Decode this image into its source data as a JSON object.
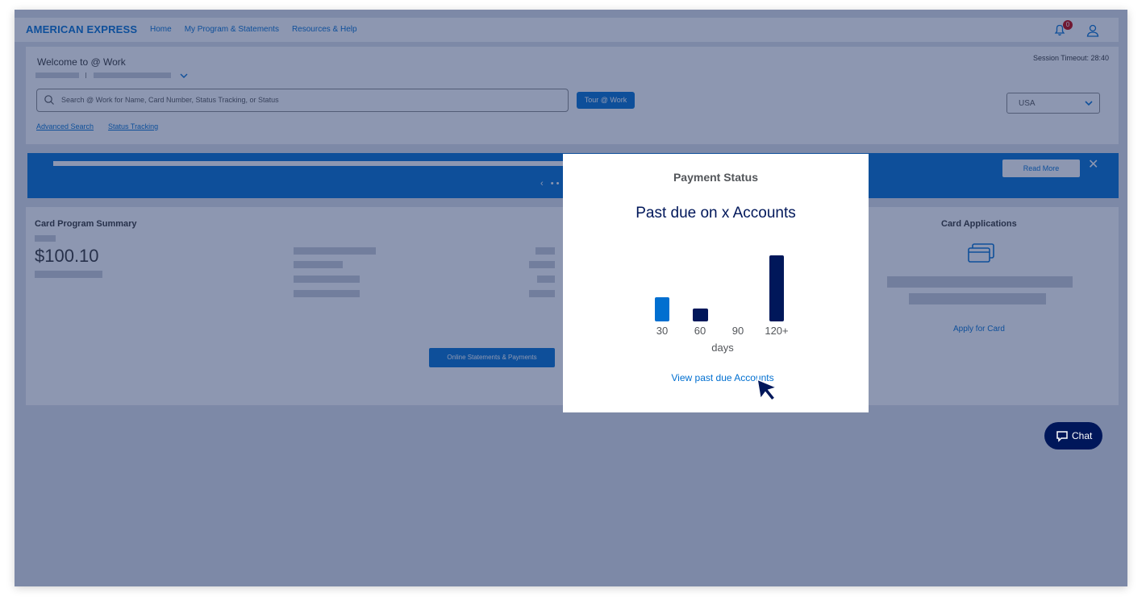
{
  "brand": {
    "logo": "AMERICAN EXPRESS",
    "accent": "#016fd0",
    "navy": "#00175a"
  },
  "nav": {
    "items": [
      "Home",
      "My Program & Statements",
      "Resources & Help"
    ]
  },
  "notifications": {
    "count": "0"
  },
  "welcome": {
    "title": "Welcome to @ Work",
    "session_timeout": "Session Timeout: 28:40",
    "search_placeholder": "Search @ Work for Name, Card Number, Status Tracking, or Status",
    "tour_button": "Tour @ Work",
    "advanced_search": "Advanced Search",
    "status_tracking": "Status Tracking",
    "country": "USA"
  },
  "banner": {
    "read_more": "Read More",
    "close": "✕",
    "carousel_nav": "‹ ••"
  },
  "summary": {
    "title": "Card Program Summary",
    "amount": "$100.10",
    "statements_button": "Online Statements & Payments"
  },
  "applications": {
    "title": "Card Applications",
    "apply_link": "Apply for Card"
  },
  "chat": {
    "label": "Chat"
  },
  "modal": {
    "title": "Payment Status",
    "heading": "Past due on x Accounts",
    "link": "View past due Accounts"
  },
  "chart_data": {
    "type": "bar",
    "title": "",
    "xlabel": "days",
    "ylabel": "",
    "categories": [
      "30",
      "60",
      "90",
      "120+"
    ],
    "values": [
      30,
      16,
      0,
      82
    ],
    "colors": [
      "#016fd0",
      "#00175a",
      "#00175a",
      "#00175a"
    ],
    "grid": false
  }
}
